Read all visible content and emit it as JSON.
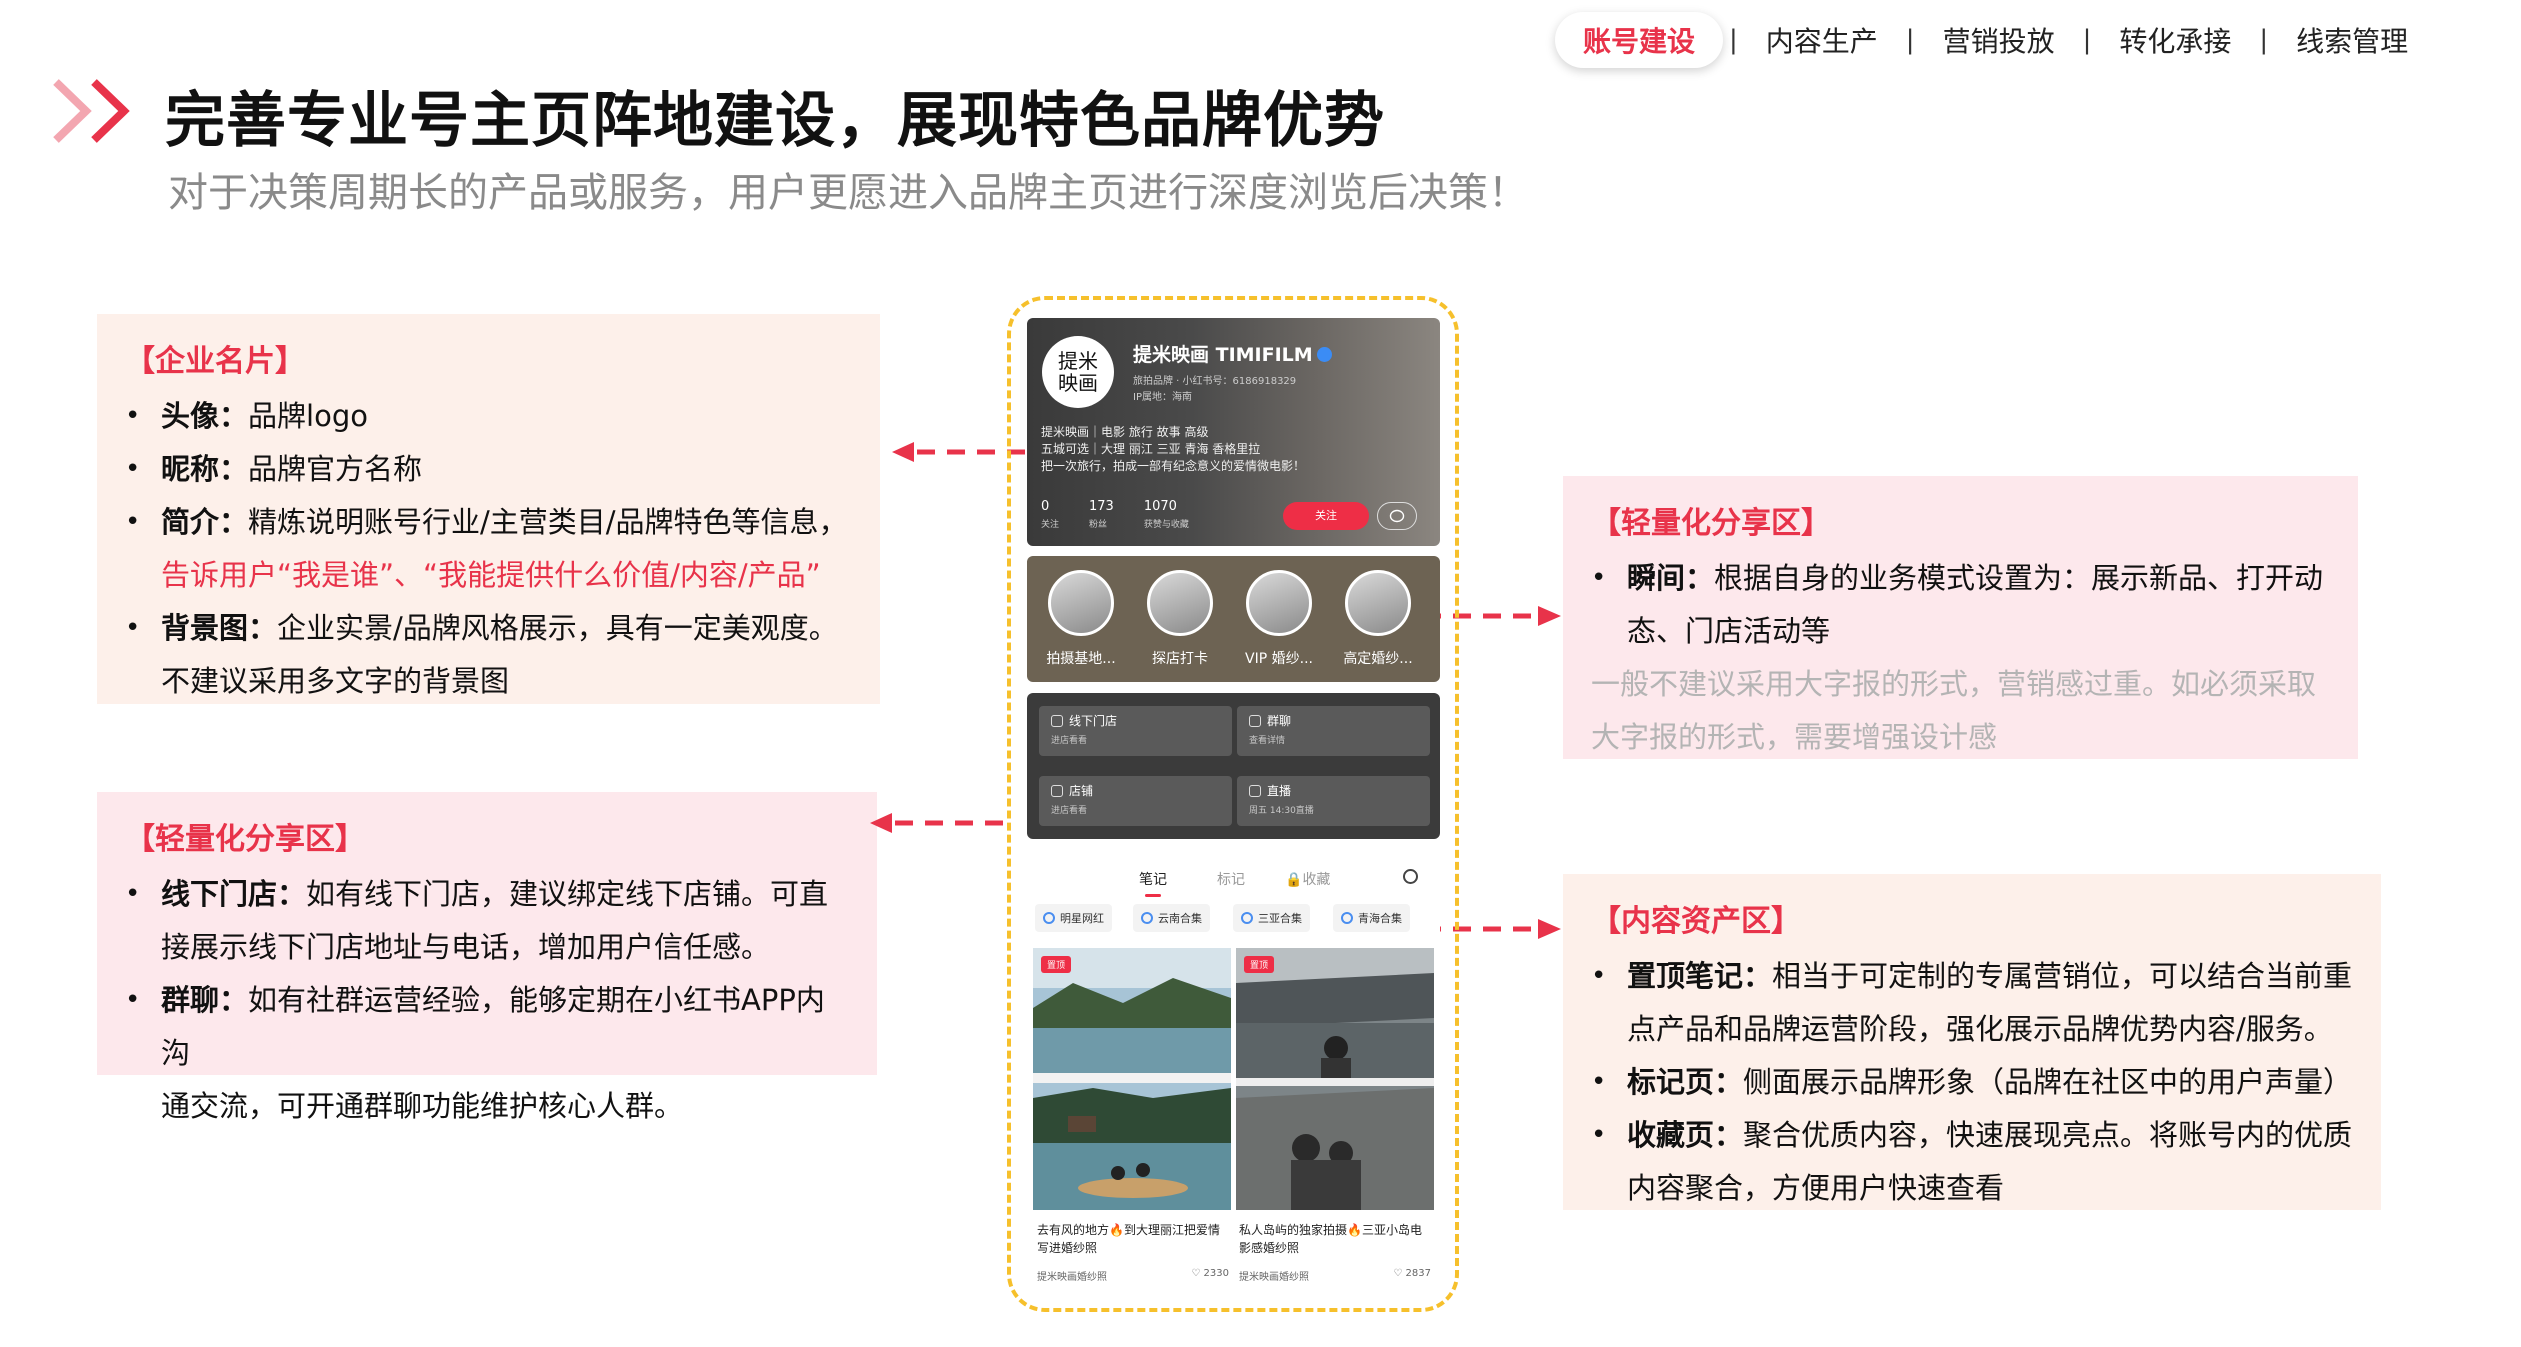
{
  "nav": {
    "items": [
      {
        "label": "账号建设",
        "active": true
      },
      {
        "label": "内容生产",
        "active": false
      },
      {
        "label": "营销投放",
        "active": false
      },
      {
        "label": "转化承接",
        "active": false
      },
      {
        "label": "线索管理",
        "active": false
      }
    ],
    "separator": "|"
  },
  "header": {
    "title": "完善专业号主页阵地建设，展现特色品牌优势",
    "subtitle": "对于决策周期长的产品或服务，用户更愿进入品牌主页进行深度浏览后决策！"
  },
  "colors": {
    "accent": "#e8334a",
    "peach_box": "#fdf0ea",
    "pink_box": "#fde8ec",
    "frame": "#f6c02c"
  },
  "box_card": {
    "heading": "【企业名片】",
    "items": [
      {
        "key": "头像：",
        "text": "品牌logo"
      },
      {
        "key": "昵称：",
        "text": "品牌官方名称"
      },
      {
        "key": "简介：",
        "text": "精炼说明账号行业/主营类目/品牌特色等信息，",
        "highlight": "告诉用户“我是谁”、“我能提供什么价值/内容/产品”"
      },
      {
        "key": "背景图：",
        "text": "企业实景/品牌风格展示，具有一定美观度。",
        "text2": "不建议采用多文字的背景图"
      }
    ]
  },
  "box_share_left": {
    "heading": "【轻量化分享区】",
    "items": [
      {
        "key": "线下门店：",
        "text": "如有线下门店，建议绑定线下店铺。可直",
        "text2": "接展示线下门店地址与电话，增加用户信任感。"
      },
      {
        "key": "群聊：",
        "text": "如有社群运营经验，能够定期在小红书APP内沟",
        "text2": "通交流，可开通群聊功能维护核心人群。"
      }
    ]
  },
  "box_share_right": {
    "heading": "【轻量化分享区】",
    "items": [
      {
        "key": "瞬间：",
        "text": "根据自身的业务模式设置为：展示新品、打开动",
        "text2": "态、门店活动等"
      }
    ],
    "note1": "一般不建议采用大字报的形式，营销感过重。如必须采取",
    "note2": "大字报的形式，需要增强设计感"
  },
  "box_content": {
    "heading": "【内容资产区】",
    "items": [
      {
        "key": "置顶笔记：",
        "text": "相当于可定制的专属营销位，可以结合当前重",
        "text2": "点产品和品牌运营阶段，强化展示品牌优势内容/服务。"
      },
      {
        "key": "标记页：",
        "text": "侧面展示品牌形象（品牌在社区中的用户声量）"
      },
      {
        "key": "收藏页：",
        "text": "聚合优质内容，快速展现亮点。将账号内的优质",
        "text2": "内容聚合，方便用户快速查看"
      }
    ]
  },
  "phone": {
    "avatar_text": "提米\n映画",
    "name": "提米映画 TIMIFILM",
    "meta1": "旅拍品牌 · 小红书号：6186918329",
    "meta2": "IP属地：海南",
    "bio": [
      "提米映画｜电影 旅行 故事 高级",
      "五城可选｜大理 丽江 三亚 青海 香格里拉",
      "把一次旅行，拍成一部有纪念意义的爱情微电影！"
    ],
    "stats": [
      {
        "value": "0",
        "label": "关注"
      },
      {
        "value": "173",
        "label": "粉丝"
      },
      {
        "value": "1070",
        "label": "获赞与收藏"
      }
    ],
    "follow_label": "关注",
    "moments": [
      "拍摄基地...",
      "探店打卡",
      "VIP 婚纱...",
      "高定婚纱..."
    ],
    "services": [
      {
        "title": "线下门店",
        "sub": "进店看看"
      },
      {
        "title": "群聊",
        "sub": "查看详情"
      },
      {
        "title": "店铺",
        "sub": "进店看看"
      },
      {
        "title": "直播",
        "sub": "周五 14:30直播"
      }
    ],
    "tabs": [
      "笔记",
      "标记",
      "收藏"
    ],
    "chips": [
      "明星网红",
      "云南合集",
      "三亚合集",
      "青海合集"
    ],
    "pin_label": "置顶",
    "notes": [
      {
        "title": "去有风的地方🔥到大理丽江把爱情写进婚纱照",
        "author": "提米映画婚纱照",
        "likes": "2330"
      },
      {
        "title": "私人岛屿的独家拍摄🔥三亚小岛电影感婚纱照",
        "author": "提米映画婚纱照",
        "likes": "2837"
      }
    ]
  }
}
